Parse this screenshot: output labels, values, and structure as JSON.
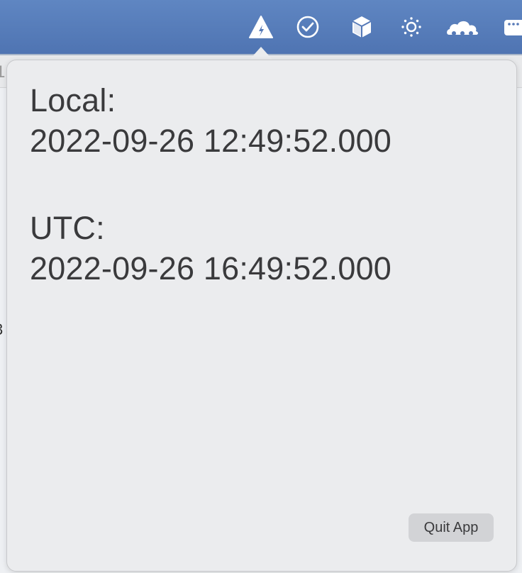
{
  "menubar": {
    "color": "#5579b7",
    "icons": [
      "bolt-triangle-icon",
      "checkmark-circle-icon",
      "cube-icon",
      "sun-icon",
      "cloud-dots-icon",
      "window-dots-icon"
    ]
  },
  "background": {
    "edge_fragment_top": "1",
    "edge_fragment_mid": "3"
  },
  "popover": {
    "local_label": "Local:",
    "local_time": "2022-09-26 12:49:52.000",
    "utc_label": "UTC:",
    "utc_time": "2022-09-26 16:49:52.000",
    "quit_label": "Quit App"
  }
}
